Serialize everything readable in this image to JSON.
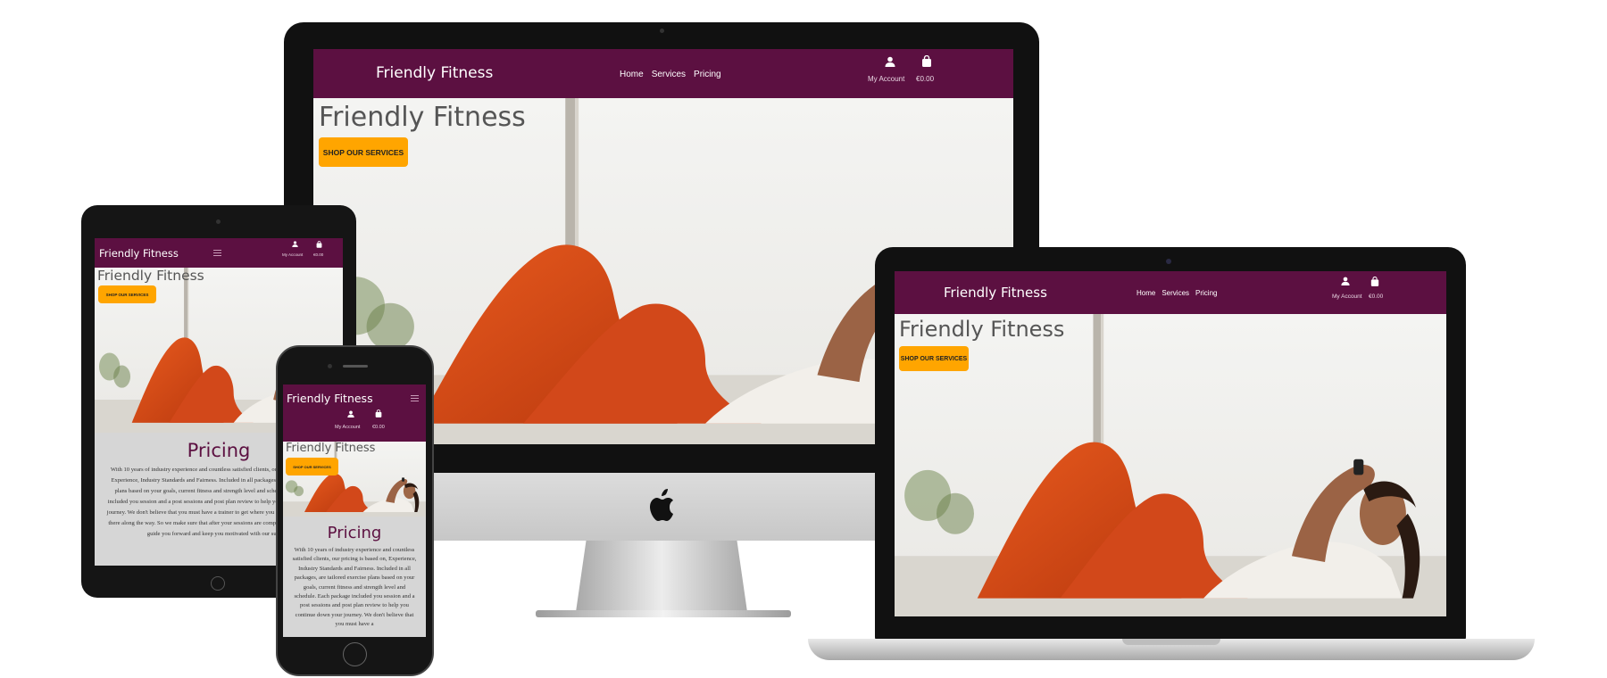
{
  "site": {
    "brand": "Friendly Fitness",
    "nav_links": [
      "Home",
      "Services",
      "Pricing"
    ],
    "account_label": "My Account",
    "cart_total": "€0.00",
    "hero_title": "Friendly Fitness",
    "shop_button": "SHOP OUR SERVICES",
    "pricing_heading": "Pricing",
    "pricing_text_tablet": "With 10 years of industry experience and countless satisfied clients, our pricing is based on, Experience, Industry Standards and Fairness. Included in all packages, are tailored exercise plans based on your goals, current fitness and strength level and schedule. Each package included you session and a post sessions and post plan review to help you continue down your journey. We don't believe that you must have a trainer to get where you want to be, but we'll be there along the way. So we make sure that after your sessions are complete you have a plan to guide you forward and keep you motivated with our support.",
    "pricing_text_phone": "With 10 years of industry experience and countless satisfied clients, our pricing is based on, Experience, Industry Standards and Fairness. Included in all packages, are tailored exercise plans based on your goals, current fitness and strength level and schedule. Each package included you session and a post sessions and post plan review to help you continue down your journey. We don't believe that you must have a"
  },
  "colors": {
    "navbar": "#5c1041",
    "button": "#ffa500",
    "heading": "#5c1041",
    "pricing_bg": "#d6d6d6"
  },
  "icons": [
    "user-icon",
    "shopping-bag-icon",
    "hamburger-menu-icon",
    "apple-logo-icon"
  ]
}
